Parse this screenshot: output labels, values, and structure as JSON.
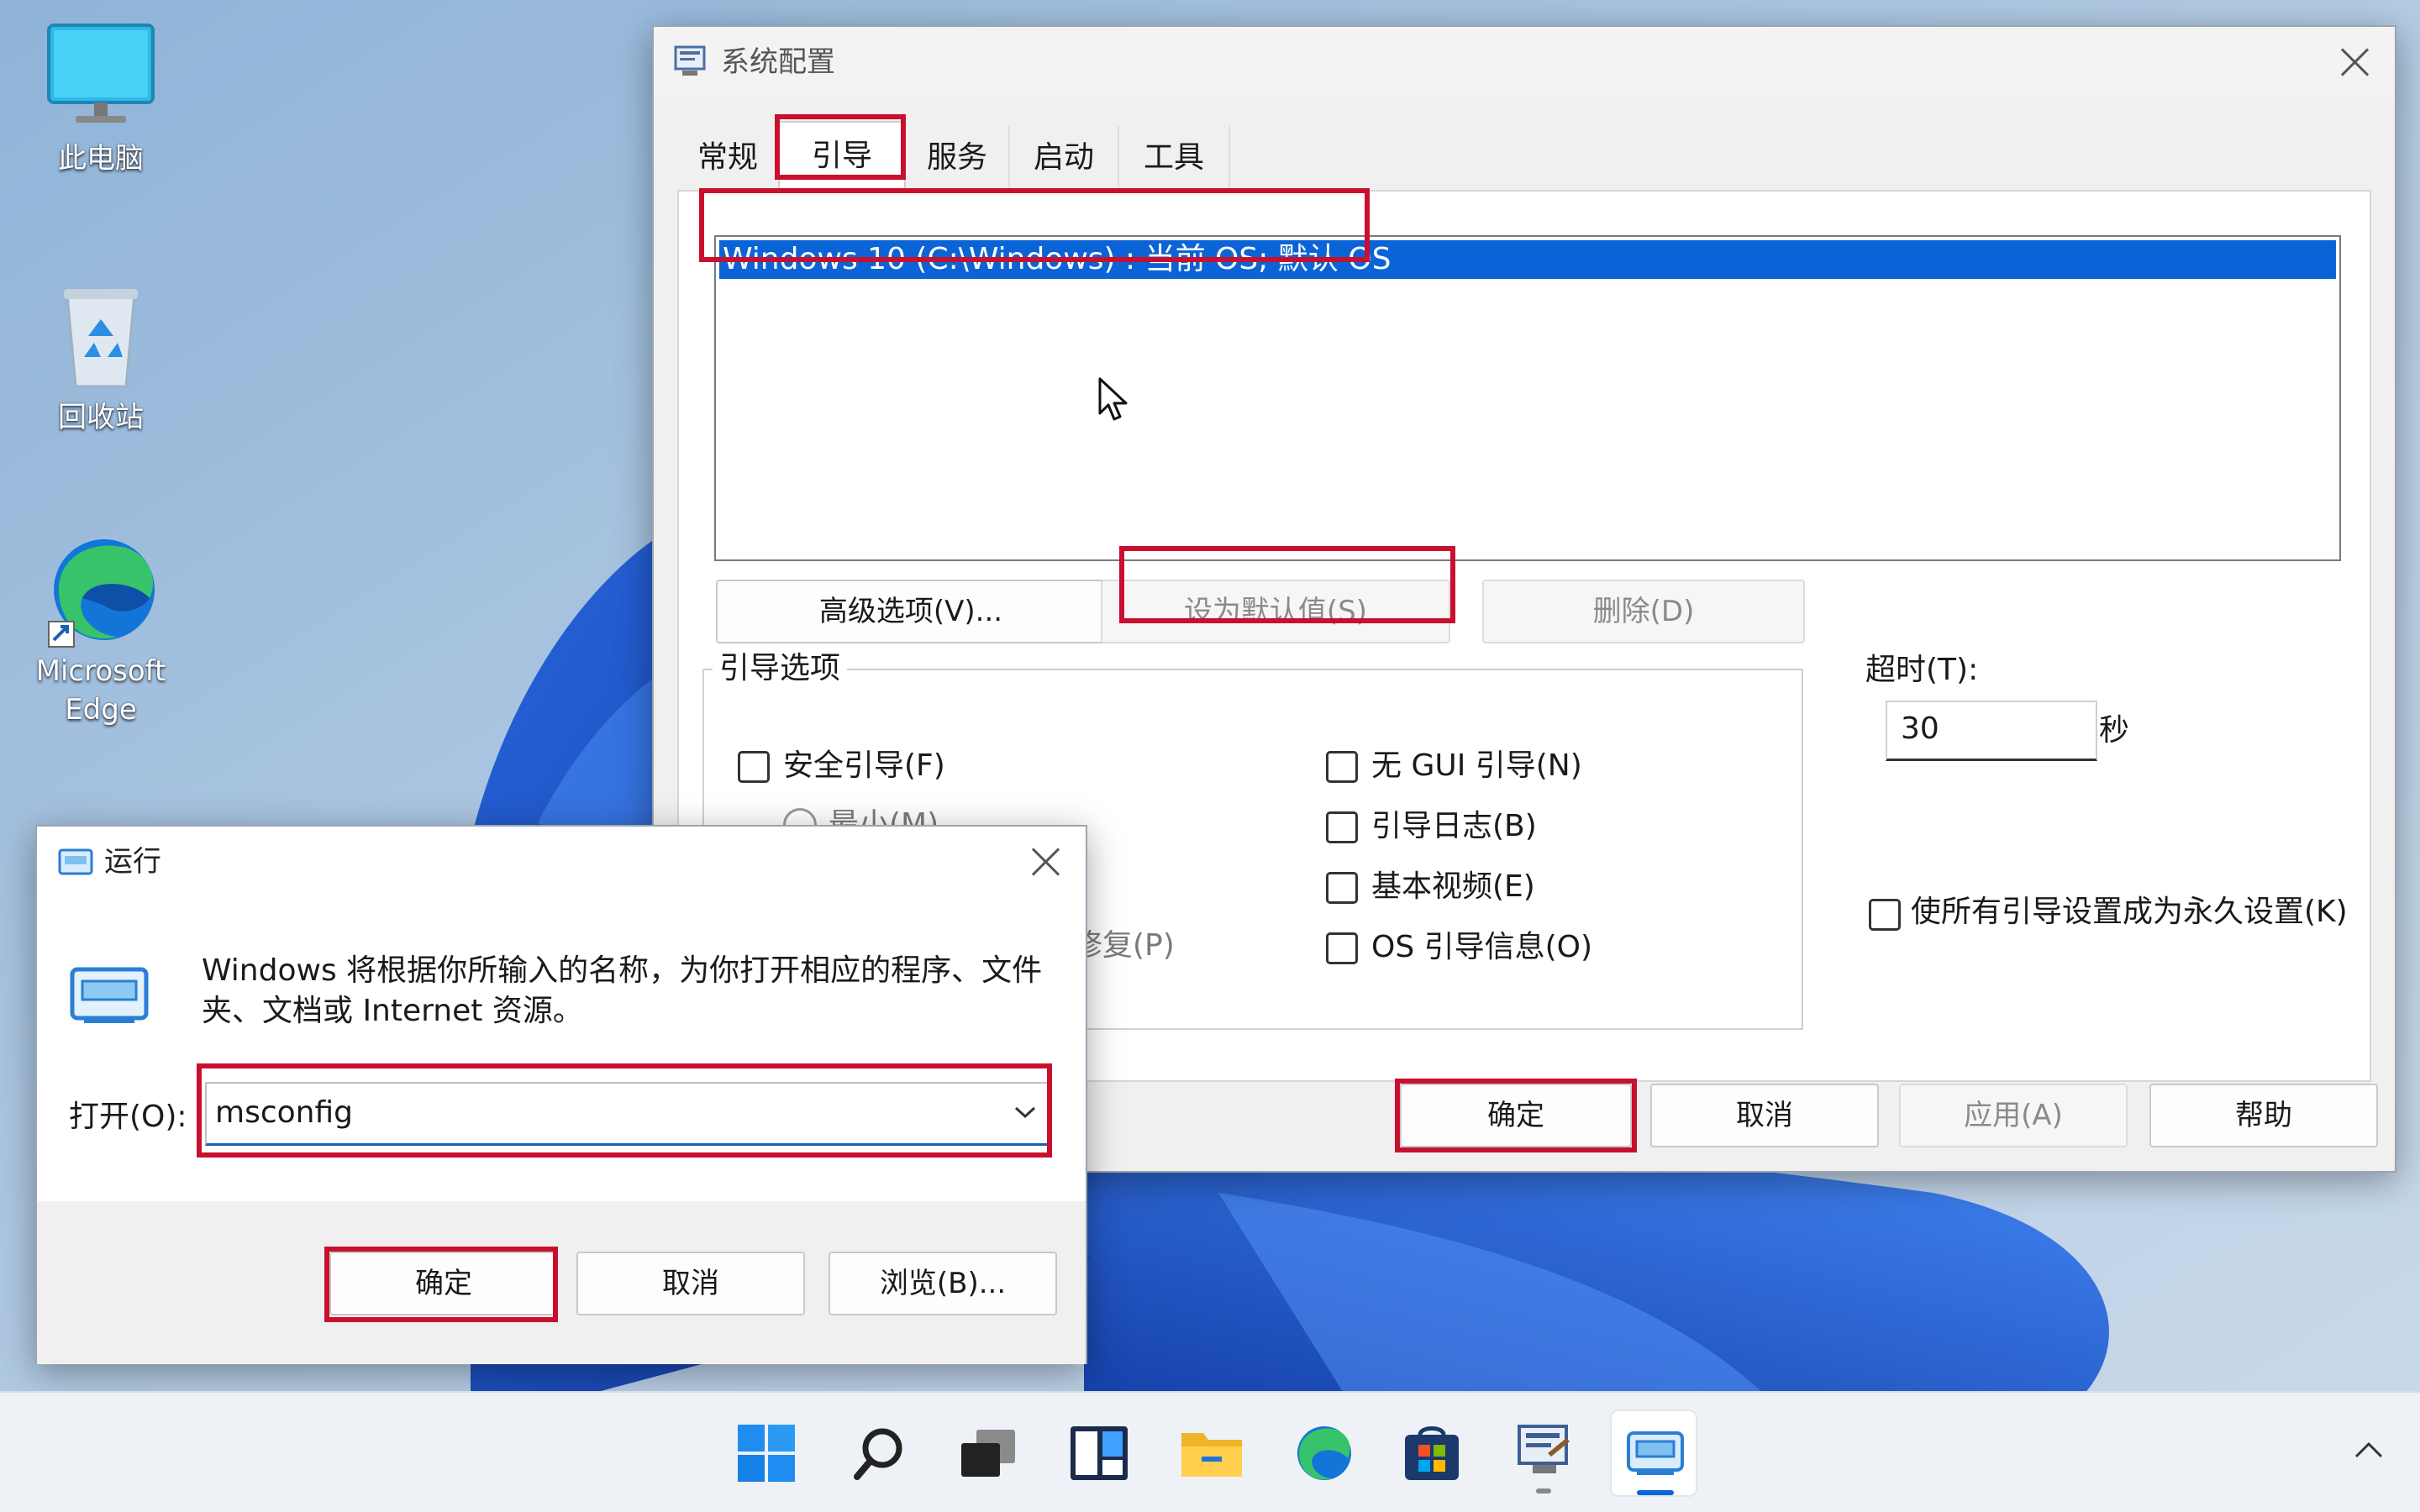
{
  "desktop": {
    "icons": [
      {
        "label": "此电脑",
        "icon": "monitor-icon"
      },
      {
        "label": "回收站",
        "icon": "recycle-bin-icon"
      },
      {
        "label_line1": "Microsoft",
        "label_line2": "Edge",
        "icon": "edge-icon"
      }
    ]
  },
  "msconfig": {
    "title": "系统配置",
    "tabs": [
      "常规",
      "引导",
      "服务",
      "启动",
      "工具"
    ],
    "selected_tab": "引导",
    "os_entry": "Windows 10 (C:\\Windows) : 当前 OS; 默认 OS",
    "buttons": {
      "advanced": "高级选项(V)...",
      "set_default": "设为默认值(S)",
      "delete": "删除(D)"
    },
    "boot_options_label": "引导选项",
    "options": {
      "safe_boot": "安全引导(F)",
      "minimal": "最小(M)",
      "repair": "修复(P)",
      "no_gui": "无 GUI 引导(N)",
      "boot_log": "引导日志(B)",
      "base_video": "基本视频(E)",
      "os_boot_info": "OS 引导信息(O)"
    },
    "timeout_label": "超时(T):",
    "timeout_value": "30",
    "timeout_unit": "秒",
    "permanent": "使所有引导设置成为永久设置(K)",
    "footer": {
      "ok": "确定",
      "cancel": "取消",
      "apply": "应用(A)",
      "help": "帮助"
    }
  },
  "run": {
    "title": "运行",
    "desc_line1": "Windows 将根据你所输入的名称，为你打开相应的程序、文件",
    "desc_line2": "夹、文档或 Internet 资源。",
    "open_label": "打开(O):",
    "open_value": "msconfig",
    "ok": "确定",
    "cancel": "取消",
    "browse": "浏览(B)..."
  },
  "taskbar": {
    "items": [
      "start-icon",
      "search-icon",
      "task-view-icon",
      "widgets-icon",
      "file-explorer-icon",
      "edge-icon",
      "store-icon",
      "msconfig-icon",
      "run-icon"
    ]
  },
  "colors": {
    "highlight": "#c8102e",
    "selection": "#0a64d8",
    "wallpaper": "#a9c4e0"
  }
}
